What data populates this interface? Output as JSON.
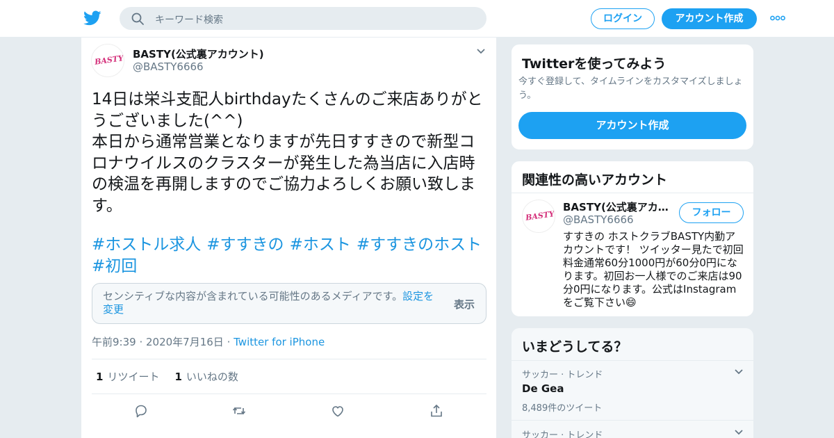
{
  "header": {
    "search_placeholder": "キーワード検索",
    "login_label": "ログイン",
    "signup_label": "アカウント作成"
  },
  "tweet": {
    "display_name": "BASTY(公式裏アカウント)",
    "handle": "@BASTY6666",
    "avatar_text": "BASTY",
    "body": "14日は栄斗支配人birthdayたくさんのご来店ありがとうございました(^^)\n本日から通常営業となりますが先日すすきので新型コロナウイルスのクラスターが発生した為当店に入店時の検温を再開しますのでご協力よろしくお願い致します。",
    "hashtags": [
      "#ホストル求人",
      "#すすきの",
      "#ホスト",
      "#すすきのホスト",
      "#初回"
    ],
    "sensitive_message": "センシティブな内容が含まれている可能性のあるメディアです。",
    "sensitive_link": "設定を変更",
    "sensitive_show": "表示",
    "time": "午前9:39",
    "date": "2020年7月16日",
    "source": "Twitter for iPhone",
    "retweet_count": "1",
    "retweet_label": "リツイート",
    "like_count": "1",
    "like_label": "いいねの数"
  },
  "sidebar": {
    "signup_card": {
      "title": "Twitterを使ってみよう",
      "description": "今すぐ登録して、タイムラインをカスタマイズしましょう。",
      "button_label": "アカウント作成"
    },
    "related_card": {
      "title": "関連性の高いアカウント",
      "account_name": "BASTY(公式裏アカウント)",
      "account_handle": "@BASTY6666",
      "follow_label": "フォロー",
      "bio": "すすきの ホストクラブBASTY内勤アカウントです！ ツイッター見たで初回料金通常60分1000円が60分0円になります。初回お一人様でのご来店は90分0円になります。公式はInstagramをご覧下さい😄"
    },
    "trends_card": {
      "title": "いまどうしてる？",
      "trends": [
        {
          "category": "サッカー · トレンド",
          "name": "De Gea",
          "count": "8,489件のツイート"
        },
        {
          "category": "サッカー · トレンド",
          "name": "",
          "count": ""
        }
      ]
    }
  },
  "colors": {
    "accent": "#1da1f2",
    "link": "#1b95e0",
    "background": "#e6ecf0"
  }
}
